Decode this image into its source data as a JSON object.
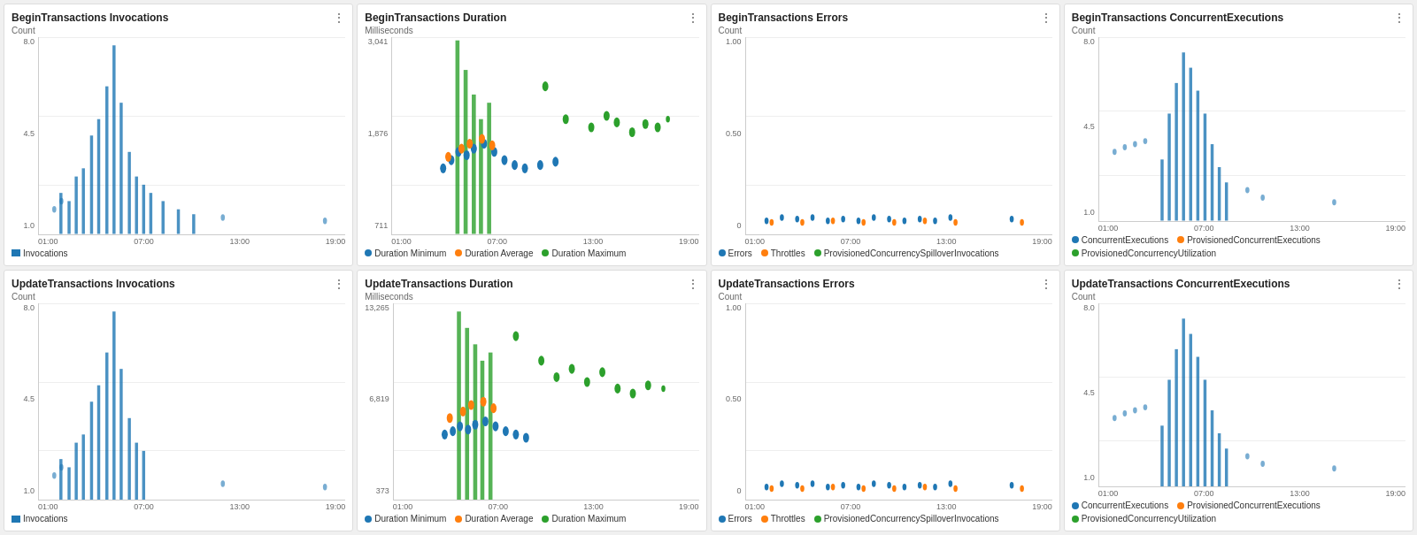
{
  "cards": [
    {
      "id": "begin-invocations",
      "title": "BeginTransactions Invocations",
      "yLabel": "Count",
      "yTicks": [
        "8.0",
        "4.5",
        "1.0"
      ],
      "xTicks": [
        "01:00",
        "07:00",
        "13:00",
        "19:00"
      ],
      "legend": [
        {
          "color": "#1f77b4",
          "label": "Invocations",
          "type": "square"
        }
      ],
      "color": "blue"
    },
    {
      "id": "begin-duration",
      "title": "BeginTransactions Duration",
      "yLabel": "Milliseconds",
      "yTicks": [
        "3,041",
        "1,876",
        "711"
      ],
      "xTicks": [
        "01:00",
        "07:00",
        "13:00",
        "19:00"
      ],
      "legend": [
        {
          "color": "#1f77b4",
          "label": "Duration Minimum",
          "type": "dot"
        },
        {
          "color": "#ff7f0e",
          "label": "Duration Average",
          "type": "dot"
        },
        {
          "color": "#2ca02c",
          "label": "Duration Maximum",
          "type": "dot"
        }
      ]
    },
    {
      "id": "begin-errors",
      "title": "BeginTransactions Errors",
      "yLabel": "Count",
      "yTicks": [
        "1.00",
        "0.50",
        "0"
      ],
      "xTicks": [
        "01:00",
        "07:00",
        "13:00",
        "19:00"
      ],
      "legend": [
        {
          "color": "#1f77b4",
          "label": "Errors",
          "type": "dot"
        },
        {
          "color": "#ff7f0e",
          "label": "Throttles",
          "type": "dot"
        },
        {
          "color": "#2ca02c",
          "label": "ProvisionedConcurrencySpilloverInvocations",
          "type": "dot"
        }
      ]
    },
    {
      "id": "begin-concurrent",
      "title": "BeginTransactions ConcurrentExecutions",
      "yLabel": "Count",
      "yTicks": [
        "8.0",
        "4.5",
        "1.0"
      ],
      "xTicks": [
        "01:00",
        "07:00",
        "13:00",
        "19:00"
      ],
      "legend": [
        {
          "color": "#1f77b4",
          "label": "ConcurrentExecutions",
          "type": "dot"
        },
        {
          "color": "#ff7f0e",
          "label": "ProvisionedConcurrentExecutions",
          "type": "dot"
        },
        {
          "color": "#2ca02c",
          "label": "ProvisionedConcurrencyUtilization",
          "type": "dot"
        }
      ]
    },
    {
      "id": "update-invocations",
      "title": "UpdateTransactions Invocations",
      "yLabel": "Count",
      "yTicks": [
        "8.0",
        "4.5",
        "1.0"
      ],
      "xTicks": [
        "01:00",
        "07:00",
        "13:00",
        "19:00"
      ],
      "legend": [
        {
          "color": "#1f77b4",
          "label": "Invocations",
          "type": "square"
        }
      ]
    },
    {
      "id": "update-duration",
      "title": "UpdateTransactions Duration",
      "yLabel": "Milliseconds",
      "yTicks": [
        "13,265",
        "6,819",
        "373"
      ],
      "xTicks": [
        "01:00",
        "07:00",
        "13:00",
        "19:00"
      ],
      "legend": [
        {
          "color": "#1f77b4",
          "label": "Duration Minimum",
          "type": "dot"
        },
        {
          "color": "#ff7f0e",
          "label": "Duration Average",
          "type": "dot"
        },
        {
          "color": "#2ca02c",
          "label": "Duration Maximum",
          "type": "dot"
        }
      ]
    },
    {
      "id": "update-errors",
      "title": "UpdateTransactions Errors",
      "yLabel": "Count",
      "yTicks": [
        "1.00",
        "0.50",
        "0"
      ],
      "xTicks": [
        "01:00",
        "07:00",
        "13:00",
        "19:00"
      ],
      "legend": [
        {
          "color": "#1f77b4",
          "label": "Errors",
          "type": "dot"
        },
        {
          "color": "#ff7f0e",
          "label": "Throttles",
          "type": "dot"
        },
        {
          "color": "#2ca02c",
          "label": "ProvisionedConcurrencySpilloverInvocations",
          "type": "dot"
        }
      ]
    },
    {
      "id": "update-concurrent",
      "title": "UpdateTransactions ConcurrentExecutions",
      "yLabel": "Count",
      "yTicks": [
        "8.0",
        "4.5",
        "1.0"
      ],
      "xTicks": [
        "01:00",
        "07:00",
        "13:00",
        "19:00"
      ],
      "legend": [
        {
          "color": "#1f77b4",
          "label": "ConcurrentExecutions",
          "type": "dot"
        },
        {
          "color": "#ff7f0e",
          "label": "ProvisionedConcurrentExecutions",
          "type": "dot"
        },
        {
          "color": "#2ca02c",
          "label": "ProvisionedConcurrencyUtilization",
          "type": "dot"
        }
      ]
    }
  ],
  "menu_icon": "⋮"
}
